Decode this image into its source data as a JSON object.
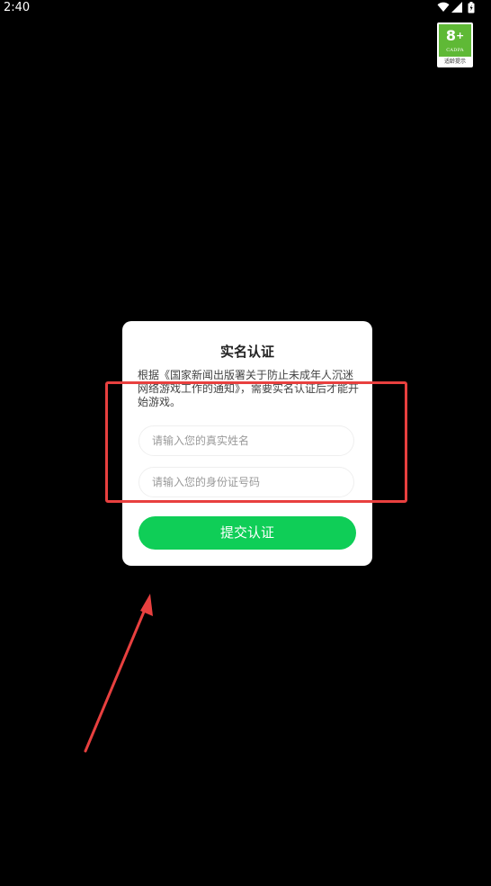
{
  "status_bar": {
    "time": "2:40"
  },
  "age_badge": {
    "number": "8",
    "plus": "+",
    "org": "CADPA",
    "caption": "适龄提示",
    "color": "#5fb936"
  },
  "dialog": {
    "title": "实名认证",
    "description": "根据《国家新闻出版署关于防止未成年人沉迷网络游戏工作的通知》，需要实名认证后才能开始游戏。",
    "name_field": {
      "placeholder": "请输入您的真实姓名",
      "value": ""
    },
    "id_field": {
      "placeholder": "请输入您的身份证号码",
      "value": ""
    },
    "submit_label": "提交认证",
    "accent_color": "#0fce57"
  },
  "annotation": {
    "color": "#e8403f"
  }
}
